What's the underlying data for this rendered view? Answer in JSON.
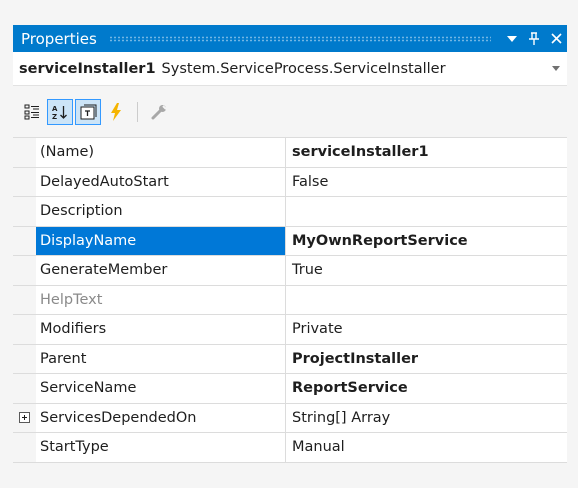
{
  "panel": {
    "title": "Properties",
    "accent_color": "#007acc",
    "buttons": [
      {
        "icon": "dropdown-arrow-icon"
      },
      {
        "icon": "pin-icon"
      },
      {
        "icon": "close-icon"
      }
    ]
  },
  "object_selector": {
    "name": "serviceInstaller1",
    "type": "System.ServiceProcess.ServiceInstaller"
  },
  "toolbar": {
    "tools": [
      {
        "icon": "categorized-icon",
        "active": false
      },
      {
        "icon": "alphabetical-sort-icon",
        "active": true
      },
      {
        "icon": "properties-icon",
        "active": true
      },
      {
        "icon": "events-lightning-icon",
        "active": false
      },
      {
        "icon": "property-pages-wrench-icon",
        "active": false
      }
    ]
  },
  "properties": [
    {
      "name": "(Name)",
      "value": "serviceInstaller1",
      "bold": true
    },
    {
      "name": "DelayedAutoStart",
      "value": "False",
      "bold": false
    },
    {
      "name": "Description",
      "value": "",
      "bold": false
    },
    {
      "name": "DisplayName",
      "value": "MyOwnReportService",
      "bold": true,
      "selected": true
    },
    {
      "name": "GenerateMember",
      "value": "True",
      "bold": false
    },
    {
      "name": "HelpText",
      "value": "",
      "bold": false,
      "disabled": true
    },
    {
      "name": "Modifiers",
      "value": "Private",
      "bold": false
    },
    {
      "name": "Parent",
      "value": "ProjectInstaller",
      "bold": true
    },
    {
      "name": "ServiceName",
      "value": "ReportService",
      "bold": true
    },
    {
      "name": "ServicesDependedOn",
      "value": "String[] Array",
      "bold": false,
      "expandable": true
    },
    {
      "name": "StartType",
      "value": "Manual",
      "bold": false
    }
  ],
  "colors": {
    "selection": "#0078d7",
    "lightning": "#f5b400"
  }
}
